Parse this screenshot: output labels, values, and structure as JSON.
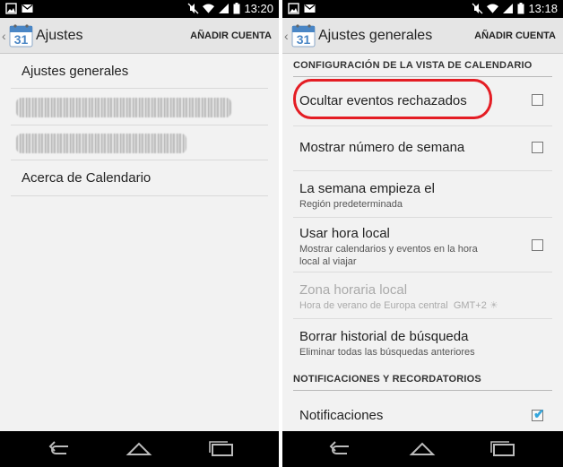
{
  "left": {
    "status": {
      "time": "13:20"
    },
    "actionbar": {
      "title": "Ajustes",
      "calendar_day": "31",
      "action": "AÑADIR CUENTA"
    },
    "items": [
      {
        "label": "Ajustes generales"
      },
      {
        "label": "Acerca de Calendario"
      }
    ]
  },
  "right": {
    "status": {
      "time": "13:18"
    },
    "actionbar": {
      "title": "Ajustes generales",
      "calendar_day": "31",
      "action": "AÑADIR CUENTA"
    },
    "section1": "CONFIGURACIÓN DE LA VISTA DE CALENDARIO",
    "rows": [
      {
        "title": "Ocultar eventos rechazados",
        "checked": false
      },
      {
        "title": "Mostrar número de semana",
        "checked": false
      },
      {
        "title": "La semana empieza el",
        "subtitle": "Región predeterminada"
      },
      {
        "title": "Usar hora local",
        "subtitle": "Mostrar calendarios y eventos en la hora local al viajar",
        "checked": false
      },
      {
        "title": "Zona horaria local",
        "subtitle": "Hora de verano de Europa central  GMT+2",
        "disabled": true
      },
      {
        "title": "Borrar historial de búsqueda",
        "subtitle": "Eliminar todas las búsquedas anteriores"
      }
    ],
    "section2": "NOTIFICACIONES Y RECORDATORIOS",
    "notif_row": {
      "title": "Notificaciones",
      "checked": true
    }
  },
  "colors": {
    "highlight": "#e41d24",
    "checkbox_check": "#33a5dc",
    "actionbar_bg": "#e5e5e5",
    "list_bg": "#f2f2f2"
  },
  "icons": [
    "image-icon",
    "gmail-icon",
    "mute-icon",
    "wifi-icon",
    "signal-icon",
    "battery-icon",
    "calendar-icon",
    "back-caret-icon",
    "nav-back-icon",
    "nav-home-icon",
    "nav-recents-icon",
    "sun-icon"
  ]
}
